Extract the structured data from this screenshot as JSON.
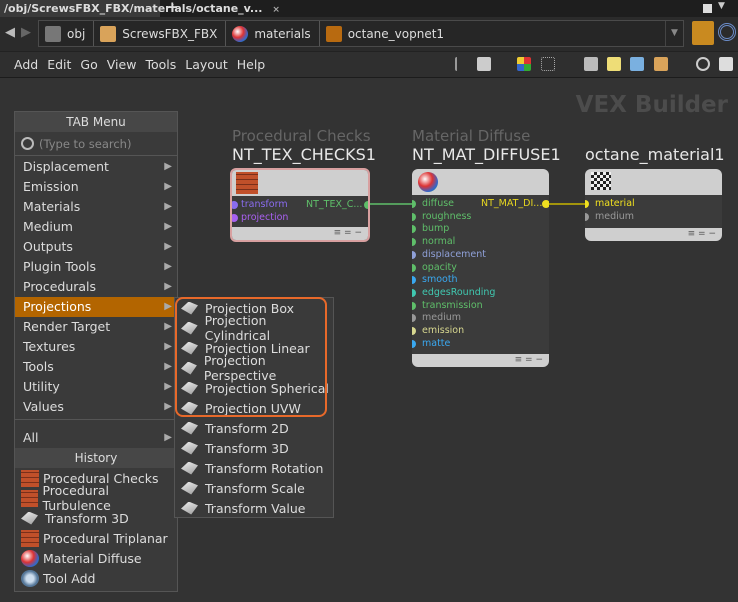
{
  "tab": {
    "title": "/obj/ScrewsFBX_FBX/materials/octane_v...",
    "close": "×",
    "add": "+"
  },
  "path": {
    "crumbs": [
      {
        "label": "obj",
        "icon": "obj-icon"
      },
      {
        "label": "ScrewsFBX_FBX",
        "icon": "box-icon"
      },
      {
        "label": "materials",
        "icon": "materials-ball-icon"
      },
      {
        "label": "octane_vopnet1",
        "icon": "octane-icon"
      }
    ]
  },
  "menubar": [
    "Add",
    "Edit",
    "Go",
    "View",
    "Tools",
    "Layout",
    "Help"
  ],
  "canvas": {
    "label": "VEX Builder"
  },
  "tab_menu": {
    "title": "TAB Menu",
    "search_placeholder": "(Type to search)",
    "items": [
      "Displacement",
      "Emission",
      "Materials",
      "Medium",
      "Outputs",
      "Plugin Tools",
      "Procedurals",
      "Projections",
      "Render Target",
      "Textures",
      "Tools",
      "Utility",
      "Values"
    ],
    "selected": "Projections",
    "all": "All",
    "history_title": "History",
    "history": [
      {
        "label": "Procedural Checks",
        "icon": "brick"
      },
      {
        "label": "Procedural Turbulence",
        "icon": "brick"
      },
      {
        "label": "Transform 3D",
        "icon": "proj"
      },
      {
        "label": "Procedural Triplanar",
        "icon": "brick"
      },
      {
        "label": "Material Diffuse",
        "icon": "ball"
      },
      {
        "label": "Tool Add",
        "icon": "gear"
      }
    ]
  },
  "submenu": [
    "Projection Box",
    "Projection Cylindrical",
    "Projection Linear",
    "Projection Perspective",
    "Projection Spherical",
    "Projection UVW",
    "Transform 2D",
    "Transform 3D",
    "Transform Rotation",
    "Transform Scale",
    "Transform Value"
  ],
  "nodes": {
    "checks": {
      "type": "Procedural Checks",
      "name": "NT_TEX_CHECKS1",
      "inputs": [
        {
          "label": "transform",
          "color": "#8a6cf0"
        },
        {
          "label": "projection",
          "color": "#a860f0"
        }
      ],
      "output": "NT_TEX_C..."
    },
    "diffuse": {
      "type": "Material Diffuse",
      "name": "NT_MAT_DIFFUSE1",
      "output": "NT_MAT_DI...",
      "inputs": [
        {
          "label": "diffuse",
          "color": "#5fbf6a"
        },
        {
          "label": "roughness",
          "color": "#5fbf6a"
        },
        {
          "label": "bump",
          "color": "#5fbf6a"
        },
        {
          "label": "normal",
          "color": "#5fbf6a"
        },
        {
          "label": "displacement",
          "color": "#8fa0d8"
        },
        {
          "label": "opacity",
          "color": "#5fbf6a"
        },
        {
          "label": "smooth",
          "color": "#3aa8f0"
        },
        {
          "label": "edgesRounding",
          "color": "#40c8b0"
        },
        {
          "label": "transmission",
          "color": "#5fbf6a"
        },
        {
          "label": "medium",
          "color": "#999999"
        },
        {
          "label": "emission",
          "color": "#d8d890"
        },
        {
          "label": "matte",
          "color": "#3aa8f0"
        }
      ]
    },
    "octane": {
      "name": "octane_material1",
      "inputs": [
        {
          "label": "material",
          "color": "#f0e020"
        },
        {
          "label": "medium",
          "color": "#999999"
        }
      ]
    }
  },
  "footer_glyphs": "≡  =  −"
}
